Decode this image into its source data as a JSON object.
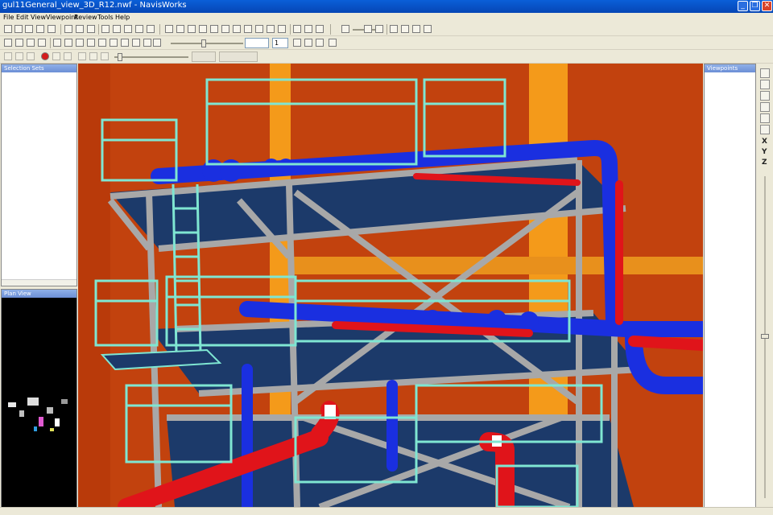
{
  "window": {
    "title": "gul11General_view_3D_R12.nwf - NavisWorks",
    "minimize": "_",
    "maximize": "❐",
    "close": "✕"
  },
  "menu": [
    "File",
    "Edit",
    "View",
    "Viewpoint",
    "Review",
    "Tools",
    "Help"
  ],
  "toolbar": {
    "selection_index": "1"
  },
  "panels": {
    "selection_sets": "Selection Sets",
    "plan_view": "Plan View",
    "viewpoints": "Viewpoints"
  },
  "axes": {
    "x": "X",
    "y": "Y",
    "z": "Z"
  },
  "colors": {
    "background": "#c2420e",
    "pipe_blue": "#1a2fe0",
    "pipe_red": "#e0141a",
    "steel": "#a8a8a8",
    "handrail": "#7fe6d2",
    "deck": "#1c3a6a",
    "column_orange": "#f49a1a"
  }
}
